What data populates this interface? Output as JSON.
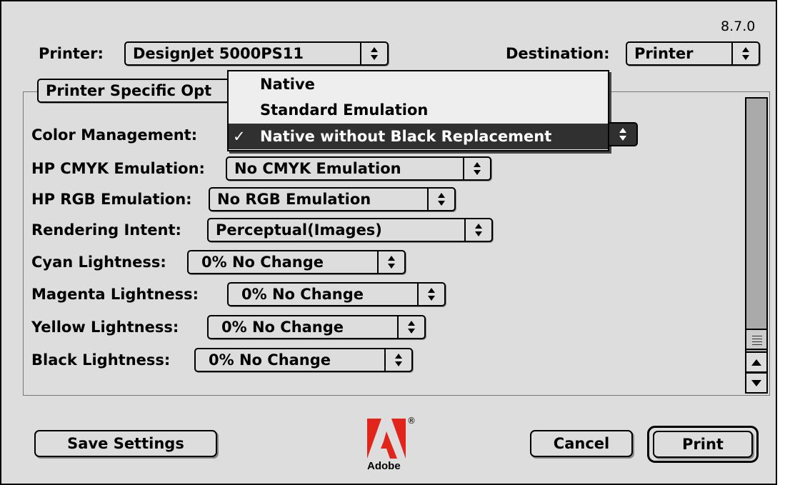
{
  "version": "8.7.0",
  "printer": {
    "label": "Printer:",
    "value": "DesignJet 5000PS11"
  },
  "destination": {
    "label": "Destination:",
    "value": "Printer"
  },
  "section_popup": {
    "value": "Printer Specific Opt"
  },
  "color_management": {
    "label": "Color Management:",
    "menu_items": [
      {
        "label": "Native",
        "checked": false
      },
      {
        "label": "Standard Emulation",
        "checked": false
      },
      {
        "label": "Native without Black Replacement",
        "checked": true
      }
    ],
    "check_mark": "✓"
  },
  "options": [
    {
      "label": "HP CMYK Emulation:",
      "value": "No CMYK Emulation"
    },
    {
      "label": "HP RGB Emulation:",
      "value": "No RGB Emulation"
    },
    {
      "label": "Rendering Intent:",
      "value": "Perceptual(Images)"
    },
    {
      "label": "Cyan Lightness:",
      "value": "0% No Change"
    },
    {
      "label": "Magenta Lightness:",
      "value": "0% No Change"
    },
    {
      "label": "Yellow Lightness:",
      "value": "0% No Change"
    },
    {
      "label": "Black Lightness:",
      "value": "0% No Change"
    }
  ],
  "buttons": {
    "save": "Save Settings",
    "cancel": "Cancel",
    "print": "Print"
  },
  "logo": {
    "text": "Adobe",
    "reg": "®",
    "color": "#e1251b"
  }
}
